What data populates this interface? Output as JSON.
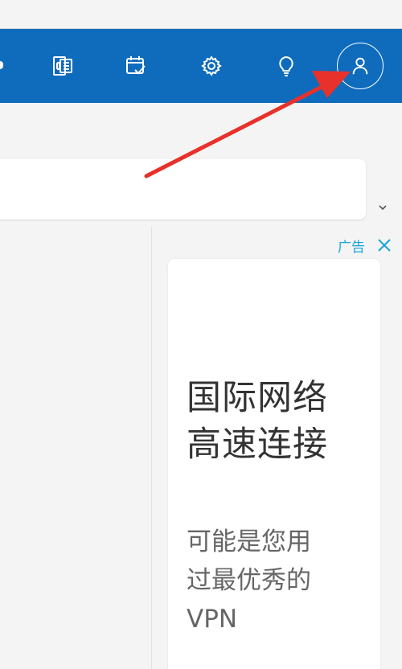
{
  "topbar": {
    "icons": [
      {
        "name": "office-apps-icon"
      },
      {
        "name": "calendar-check-icon"
      },
      {
        "name": "settings-gear-icon"
      },
      {
        "name": "tips-lightbulb-icon"
      }
    ],
    "avatar_icon": "person-icon"
  },
  "ad": {
    "tag": "广告",
    "close_icon": "close-icon",
    "headline_line1": "国际网络",
    "headline_line2": "高速连接",
    "sub_line1": "可能是您用",
    "sub_line2": "过最优秀的",
    "sub_line3": "VPN"
  },
  "colors": {
    "bar_blue": "#0f6cbd",
    "arrow_red": "#e8312a",
    "ad_tag_blue": "#1aa4d8"
  }
}
